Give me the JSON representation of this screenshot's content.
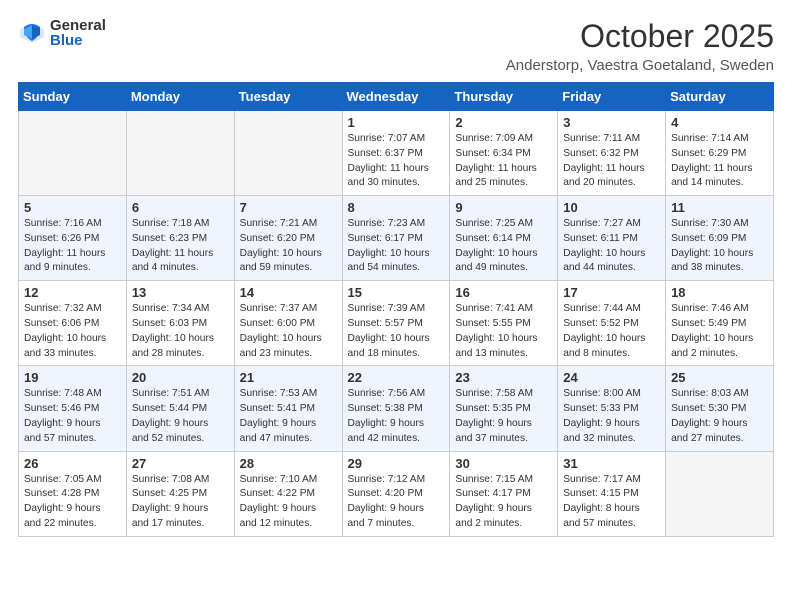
{
  "logo": {
    "general": "General",
    "blue": "Blue"
  },
  "title": "October 2025",
  "location": "Anderstorp, Vaestra Goetaland, Sweden",
  "headers": [
    "Sunday",
    "Monday",
    "Tuesday",
    "Wednesday",
    "Thursday",
    "Friday",
    "Saturday"
  ],
  "weeks": [
    [
      {
        "day": "",
        "info": ""
      },
      {
        "day": "",
        "info": ""
      },
      {
        "day": "",
        "info": ""
      },
      {
        "day": "1",
        "info": "Sunrise: 7:07 AM\nSunset: 6:37 PM\nDaylight: 11 hours\nand 30 minutes."
      },
      {
        "day": "2",
        "info": "Sunrise: 7:09 AM\nSunset: 6:34 PM\nDaylight: 11 hours\nand 25 minutes."
      },
      {
        "day": "3",
        "info": "Sunrise: 7:11 AM\nSunset: 6:32 PM\nDaylight: 11 hours\nand 20 minutes."
      },
      {
        "day": "4",
        "info": "Sunrise: 7:14 AM\nSunset: 6:29 PM\nDaylight: 11 hours\nand 14 minutes."
      }
    ],
    [
      {
        "day": "5",
        "info": "Sunrise: 7:16 AM\nSunset: 6:26 PM\nDaylight: 11 hours\nand 9 minutes."
      },
      {
        "day": "6",
        "info": "Sunrise: 7:18 AM\nSunset: 6:23 PM\nDaylight: 11 hours\nand 4 minutes."
      },
      {
        "day": "7",
        "info": "Sunrise: 7:21 AM\nSunset: 6:20 PM\nDaylight: 10 hours\nand 59 minutes."
      },
      {
        "day": "8",
        "info": "Sunrise: 7:23 AM\nSunset: 6:17 PM\nDaylight: 10 hours\nand 54 minutes."
      },
      {
        "day": "9",
        "info": "Sunrise: 7:25 AM\nSunset: 6:14 PM\nDaylight: 10 hours\nand 49 minutes."
      },
      {
        "day": "10",
        "info": "Sunrise: 7:27 AM\nSunset: 6:11 PM\nDaylight: 10 hours\nand 44 minutes."
      },
      {
        "day": "11",
        "info": "Sunrise: 7:30 AM\nSunset: 6:09 PM\nDaylight: 10 hours\nand 38 minutes."
      }
    ],
    [
      {
        "day": "12",
        "info": "Sunrise: 7:32 AM\nSunset: 6:06 PM\nDaylight: 10 hours\nand 33 minutes."
      },
      {
        "day": "13",
        "info": "Sunrise: 7:34 AM\nSunset: 6:03 PM\nDaylight: 10 hours\nand 28 minutes."
      },
      {
        "day": "14",
        "info": "Sunrise: 7:37 AM\nSunset: 6:00 PM\nDaylight: 10 hours\nand 23 minutes."
      },
      {
        "day": "15",
        "info": "Sunrise: 7:39 AM\nSunset: 5:57 PM\nDaylight: 10 hours\nand 18 minutes."
      },
      {
        "day": "16",
        "info": "Sunrise: 7:41 AM\nSunset: 5:55 PM\nDaylight: 10 hours\nand 13 minutes."
      },
      {
        "day": "17",
        "info": "Sunrise: 7:44 AM\nSunset: 5:52 PM\nDaylight: 10 hours\nand 8 minutes."
      },
      {
        "day": "18",
        "info": "Sunrise: 7:46 AM\nSunset: 5:49 PM\nDaylight: 10 hours\nand 2 minutes."
      }
    ],
    [
      {
        "day": "19",
        "info": "Sunrise: 7:48 AM\nSunset: 5:46 PM\nDaylight: 9 hours\nand 57 minutes."
      },
      {
        "day": "20",
        "info": "Sunrise: 7:51 AM\nSunset: 5:44 PM\nDaylight: 9 hours\nand 52 minutes."
      },
      {
        "day": "21",
        "info": "Sunrise: 7:53 AM\nSunset: 5:41 PM\nDaylight: 9 hours\nand 47 minutes."
      },
      {
        "day": "22",
        "info": "Sunrise: 7:56 AM\nSunset: 5:38 PM\nDaylight: 9 hours\nand 42 minutes."
      },
      {
        "day": "23",
        "info": "Sunrise: 7:58 AM\nSunset: 5:35 PM\nDaylight: 9 hours\nand 37 minutes."
      },
      {
        "day": "24",
        "info": "Sunrise: 8:00 AM\nSunset: 5:33 PM\nDaylight: 9 hours\nand 32 minutes."
      },
      {
        "day": "25",
        "info": "Sunrise: 8:03 AM\nSunset: 5:30 PM\nDaylight: 9 hours\nand 27 minutes."
      }
    ],
    [
      {
        "day": "26",
        "info": "Sunrise: 7:05 AM\nSunset: 4:28 PM\nDaylight: 9 hours\nand 22 minutes."
      },
      {
        "day": "27",
        "info": "Sunrise: 7:08 AM\nSunset: 4:25 PM\nDaylight: 9 hours\nand 17 minutes."
      },
      {
        "day": "28",
        "info": "Sunrise: 7:10 AM\nSunset: 4:22 PM\nDaylight: 9 hours\nand 12 minutes."
      },
      {
        "day": "29",
        "info": "Sunrise: 7:12 AM\nSunset: 4:20 PM\nDaylight: 9 hours\nand 7 minutes."
      },
      {
        "day": "30",
        "info": "Sunrise: 7:15 AM\nSunset: 4:17 PM\nDaylight: 9 hours\nand 2 minutes."
      },
      {
        "day": "31",
        "info": "Sunrise: 7:17 AM\nSunset: 4:15 PM\nDaylight: 8 hours\nand 57 minutes."
      },
      {
        "day": "",
        "info": ""
      }
    ]
  ]
}
